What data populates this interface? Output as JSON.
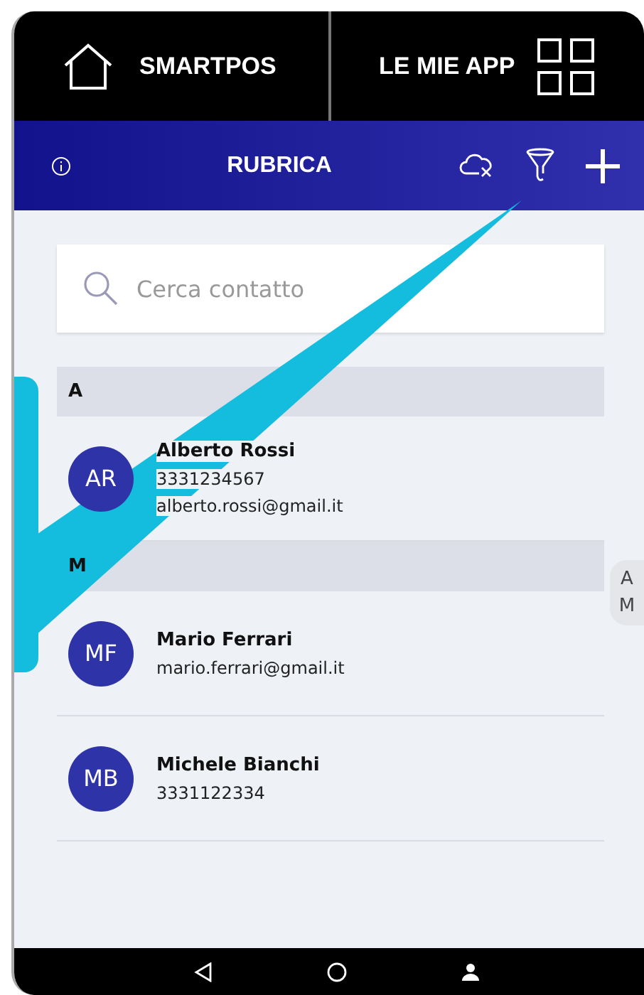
{
  "top_nav": [
    {
      "label": "SMARTPOS"
    },
    {
      "label": "LE MIE APP"
    }
  ],
  "toolbar": {
    "title": "RUBRICA"
  },
  "search": {
    "placeholder": "Cerca contatto"
  },
  "sections": [
    {
      "letter": "A",
      "contacts": [
        {
          "initials": "AR",
          "name": "Alberto Rossi",
          "lines": [
            "3331234567",
            "alberto.rossi@gmail.it"
          ]
        }
      ]
    },
    {
      "letter": "M",
      "contacts": [
        {
          "initials": "MF",
          "name": "Mario Ferrari",
          "lines": [
            "mario.ferrari@gmail.it"
          ]
        },
        {
          "initials": "MB",
          "name": "Michele Bianchi",
          "lines": [
            "3331122334"
          ]
        }
      ]
    }
  ],
  "index_bar": [
    "A",
    "M"
  ]
}
